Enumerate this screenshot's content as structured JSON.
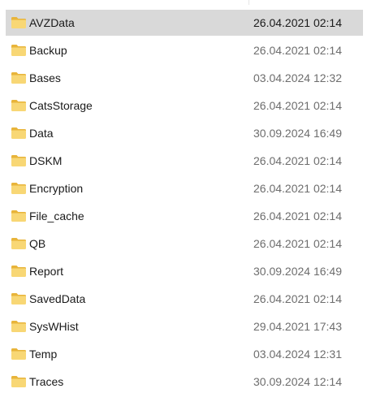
{
  "file_list": {
    "selected_index": 0,
    "items": [
      {
        "name": "AVZData",
        "modified": "26.04.2021 02:14",
        "icon": "folder-icon"
      },
      {
        "name": "Backup",
        "modified": "26.04.2021 02:14",
        "icon": "folder-icon"
      },
      {
        "name": "Bases",
        "modified": "03.04.2024 12:32",
        "icon": "folder-icon"
      },
      {
        "name": "CatsStorage",
        "modified": "26.04.2021 02:14",
        "icon": "folder-icon"
      },
      {
        "name": "Data",
        "modified": "30.09.2024 16:49",
        "icon": "folder-icon"
      },
      {
        "name": "DSKM",
        "modified": "26.04.2021 02:14",
        "icon": "folder-icon"
      },
      {
        "name": "Encryption",
        "modified": "26.04.2021 02:14",
        "icon": "folder-icon"
      },
      {
        "name": "File_cache",
        "modified": "26.04.2021 02:14",
        "icon": "folder-icon"
      },
      {
        "name": "QB",
        "modified": "26.04.2021 02:14",
        "icon": "folder-icon"
      },
      {
        "name": "Report",
        "modified": "30.09.2024 16:49",
        "icon": "folder-icon"
      },
      {
        "name": "SavedData",
        "modified": "26.04.2021 02:14",
        "icon": "folder-icon"
      },
      {
        "name": "SysWHist",
        "modified": "29.04.2021 17:43",
        "icon": "folder-icon"
      },
      {
        "name": "Temp",
        "modified": "03.04.2024 12:31",
        "icon": "folder-icon"
      },
      {
        "name": "Traces",
        "modified": "30.09.2024 12:14",
        "icon": "folder-icon"
      }
    ]
  },
  "colors": {
    "selected_row": "#d9d9d9",
    "folder_front": "#f8d775",
    "folder_back": "#e8b43a",
    "date_text": "#6d6d6d",
    "name_text": "#1a1a1a"
  }
}
